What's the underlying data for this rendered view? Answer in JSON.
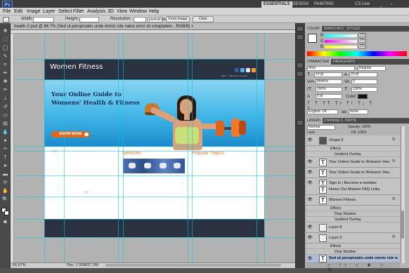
{
  "app": {
    "logo": "Ps"
  },
  "workspaces": {
    "essentials": "ESSENTIALS",
    "design": "DESIGN",
    "painting": "PAINTING",
    "cs_live": "CS Live"
  },
  "window_controls": "_ ▫ ✕",
  "menu": [
    "File",
    "Edit",
    "Image",
    "Layer",
    "Select",
    "Filter",
    "Analysis",
    "3D",
    "View",
    "Window",
    "Help"
  ],
  "options": {
    "style_label": "Style:",
    "width_label": "Width:",
    "height_label": "Height:",
    "resolution_label": "Resolution:",
    "resolution_unit": "pixels/inch",
    "front_image_button": "Front Image",
    "clear_button": "Clear"
  },
  "document": {
    "tab_title": "health-2.psd @ 66.7% (Sed ut perspiciatis unde omnis iste natus error sit voluptatem , RGB/8) ×",
    "zoom": "66.67%",
    "doc_size": "Doc: 2.93M/27.3M"
  },
  "site": {
    "title": "Women Fitness",
    "header_nav": "Sign in · Become a member",
    "hero_text": "Your Online Guide to Womens' Health & Fitness",
    "know_more": "KNOW MORE",
    "services_heading": "Services",
    "popular_heading": "Popular Topics",
    "quote_open": "“",
    "quote_close": "”"
  },
  "panels": {
    "color_tabs": [
      "COLOR",
      "SWATCHES",
      "STYLES"
    ],
    "color_values": {
      "r": "255",
      "g": "255",
      "b": "255"
    },
    "character_tabs": [
      "CHARACTER",
      "PARAGRAPH"
    ],
    "character": {
      "font_family": "Arial",
      "font_style": "Regular",
      "font_size": "14 pt",
      "leading": "20 pt",
      "tracking": "0",
      "kerning": "Metrics",
      "vertical_scale": "100%",
      "horizontal_scale": "100%",
      "baseline": "0 pt",
      "color_label": "Color:",
      "language": "English: UK",
      "anti_alias": "None"
    },
    "layers_tabs": [
      "LAYERS",
      "CHANNELS",
      "PATHS"
    ],
    "layers_blend": "Normal",
    "layers_opacity": "Opacity: 100%",
    "layers_lock": "Lock:",
    "layers_fill": "Fill: 100%"
  },
  "layers": [
    {
      "type": "layer",
      "thumb": "",
      "name": "Shape 5",
      "fx": true
    },
    {
      "type": "sub",
      "name": "Effects"
    },
    {
      "type": "sub",
      "name": "Gradient Overlay"
    },
    {
      "type": "layer",
      "thumb": "T",
      "name": "Your Online Guide to Womens' Health & Fit...",
      "fx": true
    },
    {
      "type": "layer",
      "thumb": "T",
      "name": "Your Online Guide to Womens' Health & Fit...",
      "fx": false
    },
    {
      "type": "layer",
      "thumb": "T",
      "name": "Sign In | Become a member",
      "fx": false
    },
    {
      "type": "layer",
      "thumb": "T",
      "name": "Home      Our Mission      FAQ      Links",
      "fx": false
    },
    {
      "type": "layer",
      "thumb": "T",
      "name": "Women Fitness",
      "fx": true
    },
    {
      "type": "sub",
      "name": "Effects"
    },
    {
      "type": "sub",
      "name": "Drop Shadow"
    },
    {
      "type": "sub",
      "name": "Gradient Overlay"
    },
    {
      "type": "layer",
      "thumb": "",
      "name": "Layer 8",
      "fx": false
    },
    {
      "type": "layer",
      "thumb": "",
      "name": "Layer 6",
      "fx": true
    },
    {
      "type": "sub",
      "name": "Effects"
    },
    {
      "type": "sub",
      "name": "Drop Shadow"
    },
    {
      "type": "layer",
      "thumb": "T",
      "name": "Sed ut perspiciatis unde omnis iste natus...",
      "fx": false,
      "selected": true
    }
  ],
  "colors": {
    "accent_orange": "#e27a2a",
    "hero_blue": "#3fb4e7",
    "header_dark": "#2a3140",
    "selected_layer": "#b0bcd6"
  }
}
